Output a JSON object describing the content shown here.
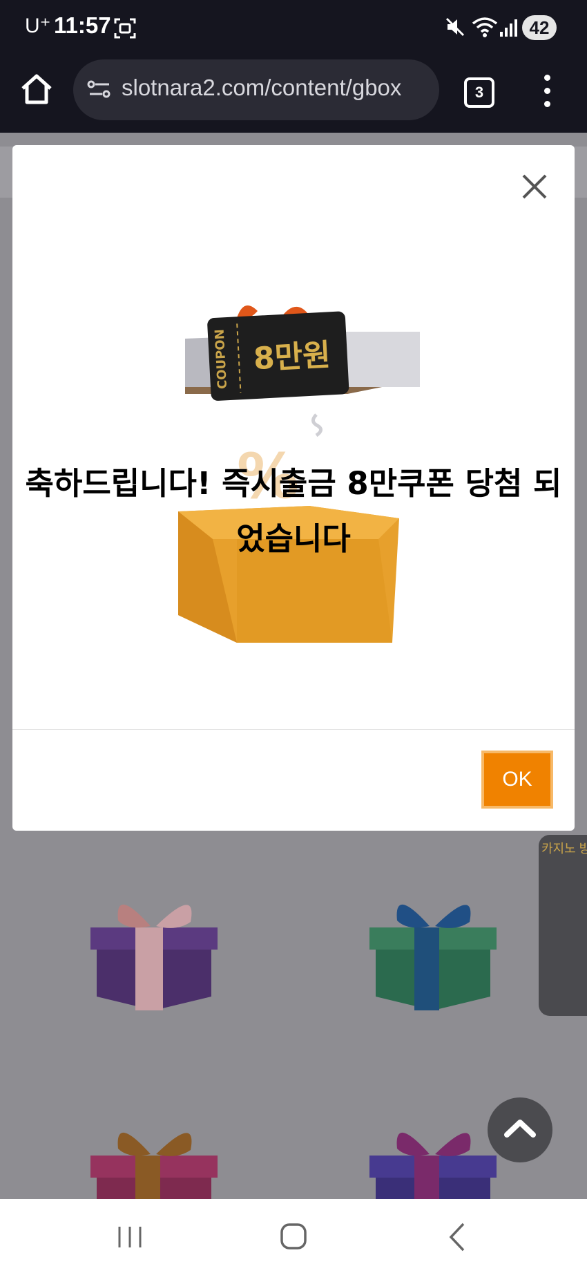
{
  "status_bar": {
    "carrier": "U⁺",
    "time": "11:57",
    "battery": "42",
    "icons": [
      "screenshot-icon",
      "mute-icon",
      "wifi-icon",
      "signal-icon",
      "battery-icon"
    ]
  },
  "browser": {
    "url": "slotnara2.com/content/gbox",
    "tab_count": "3",
    "icons": [
      "home-icon",
      "site-info-icon",
      "more-vert-icon"
    ]
  },
  "dialog": {
    "message": "축하드립니다! 즉시출금 8만쿠폰 당첨 되었습니다",
    "ok_label": "OK",
    "illustration": {
      "coupon_label": "COUPON",
      "coupon_amount": "8만원"
    },
    "colors": {
      "ok_button": "#f08200",
      "ok_border": "#f7b968"
    }
  },
  "background": {
    "side_card_text": "카지노 방송"
  },
  "nav_bar": {
    "icons": [
      "recent-apps-icon",
      "home-nav-icon",
      "back-icon"
    ]
  }
}
